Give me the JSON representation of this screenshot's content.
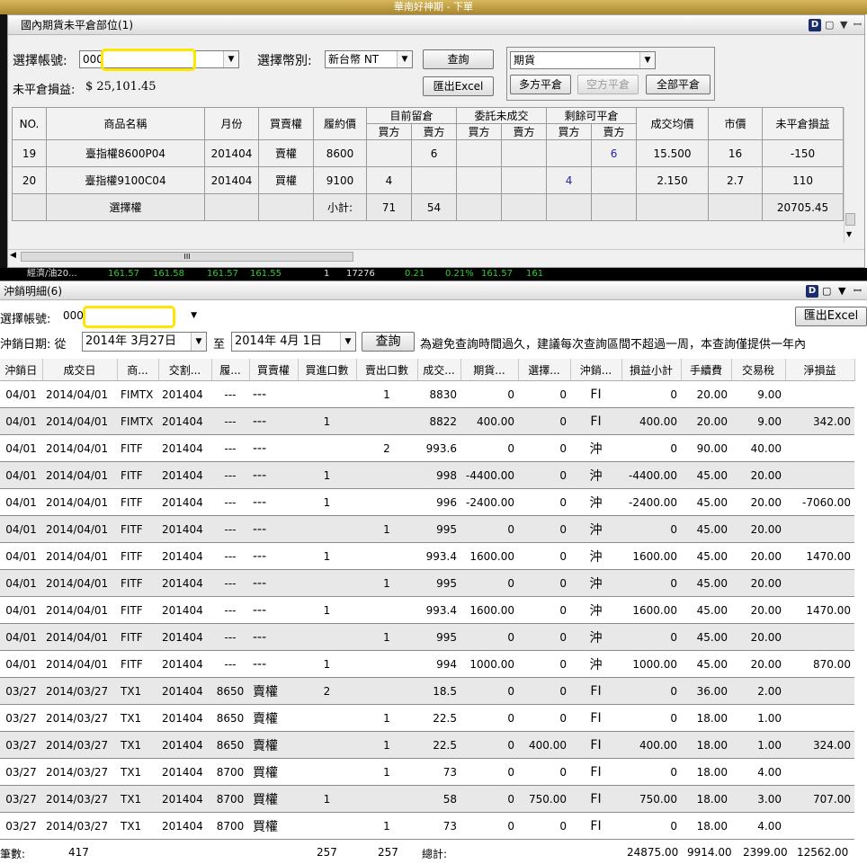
{
  "window": {
    "title": "華南好神期 - 下單"
  },
  "panel1": {
    "title": "國內期貨未平倉部位(1)",
    "account_label": "選擇帳號:",
    "account_value": "000",
    "currency_label": "選擇幣別:",
    "currency_value": "新台幣 NT",
    "query_button": "查詢",
    "export_button": "匯出Excel",
    "product_type": "期貨",
    "btn_long_close": "多方平倉",
    "btn_short_close": "空方平倉",
    "btn_all_close": "全部平倉",
    "unrealized_label": "未平倉損益:",
    "unrealized_value": "$ 25,101.45",
    "columns": {
      "no": "NO.",
      "product": "商品名稱",
      "month": "月份",
      "buysell": "買賣權",
      "strike": "履約價",
      "current_hold": "目前留倉",
      "pending": "委託未成交",
      "remaining": "剩餘可平倉",
      "buy": "買方",
      "sell": "賣方",
      "avg_price": "成交均價",
      "market_price": "市價",
      "unrealized_pl": "未平倉損益"
    },
    "rows": [
      {
        "no": "19",
        "product": "臺指權8600P04",
        "month": "201404",
        "buysell": "賣權",
        "strike": "8600",
        "hold_buy": "",
        "hold_sell": "6",
        "pend_buy": "",
        "pend_sell": "",
        "rem_buy": "",
        "rem_sell": "6",
        "avg": "15.500",
        "mkt": "16",
        "pl": "-150"
      },
      {
        "no": "20",
        "product": "臺指權9100C04",
        "month": "201404",
        "buysell": "買權",
        "strike": "9100",
        "hold_buy": "4",
        "hold_sell": "",
        "pend_buy": "",
        "pend_sell": "",
        "rem_buy": "4",
        "rem_sell": "",
        "avg": "2.150",
        "mkt": "2.7",
        "pl": "110"
      }
    ],
    "subtotal": {
      "product": "選擇權",
      "label": "小計:",
      "hold_buy": "71",
      "hold_sell": "54",
      "pl": "20705.45"
    },
    "scroll_grip": "III",
    "ticker_row": [
      "經濟/油20...",
      "161.57",
      "161.58",
      "161.57",
      "161.55",
      "1",
      "17276",
      "0.21",
      "0.21%",
      "161.57",
      "161"
    ]
  },
  "panel2": {
    "title": "沖銷明細(6)",
    "account_label": "選擇帳號:",
    "account_value": "000",
    "export_button": "匯出Excel",
    "date_label": "沖銷日期: 從",
    "date_from": "2014年  3月27日",
    "date_to_label": "至",
    "date_to": "2014年  4月  1日",
    "query_button": "查詢",
    "notice": "為避免查詢時間過久，建議每次查詢區間不超過一周，本查詢僅提供一年內",
    "columns": [
      "沖銷日",
      "成交日",
      "商...",
      "交割...",
      "履...",
      "買賣權",
      "買進口數",
      "賣出口數",
      "成交...",
      "期貨...",
      "選擇...",
      "沖銷...",
      "損益小計",
      "手續費",
      "交易稅",
      "淨損益"
    ],
    "rows": [
      [
        "04/01",
        "2014/04/01",
        "FIMTX",
        "201404",
        "---",
        "---",
        "",
        "1",
        "8830",
        "0",
        "0",
        "FI",
        "0",
        "20.00",
        "9.00",
        ""
      ],
      [
        "04/01",
        "2014/04/01",
        "FIMTX",
        "201404",
        "---",
        "---",
        "1",
        "",
        "8822",
        "400.00",
        "0",
        "FI",
        "400.00",
        "20.00",
        "9.00",
        "342.00"
      ],
      [
        "04/01",
        "2014/04/01",
        "FITF",
        "201404",
        "---",
        "---",
        "",
        "2",
        "993.6",
        "0",
        "0",
        "沖",
        "0",
        "90.00",
        "40.00",
        ""
      ],
      [
        "04/01",
        "2014/04/01",
        "FITF",
        "201404",
        "---",
        "---",
        "1",
        "",
        "998",
        "-4400.00",
        "0",
        "沖",
        "-4400.00",
        "45.00",
        "20.00",
        ""
      ],
      [
        "04/01",
        "2014/04/01",
        "FITF",
        "201404",
        "---",
        "---",
        "1",
        "",
        "996",
        "-2400.00",
        "0",
        "沖",
        "-2400.00",
        "45.00",
        "20.00",
        "-7060.00"
      ],
      [
        "04/01",
        "2014/04/01",
        "FITF",
        "201404",
        "---",
        "---",
        "",
        "1",
        "995",
        "0",
        "0",
        "沖",
        "0",
        "45.00",
        "20.00",
        ""
      ],
      [
        "04/01",
        "2014/04/01",
        "FITF",
        "201404",
        "---",
        "---",
        "1",
        "",
        "993.4",
        "1600.00",
        "0",
        "沖",
        "1600.00",
        "45.00",
        "20.00",
        "1470.00"
      ],
      [
        "04/01",
        "2014/04/01",
        "FITF",
        "201404",
        "---",
        "---",
        "",
        "1",
        "995",
        "0",
        "0",
        "沖",
        "0",
        "45.00",
        "20.00",
        ""
      ],
      [
        "04/01",
        "2014/04/01",
        "FITF",
        "201404",
        "---",
        "---",
        "1",
        "",
        "993.4",
        "1600.00",
        "0",
        "沖",
        "1600.00",
        "45.00",
        "20.00",
        "1470.00"
      ],
      [
        "04/01",
        "2014/04/01",
        "FITF",
        "201404",
        "---",
        "---",
        "",
        "1",
        "995",
        "0",
        "0",
        "沖",
        "0",
        "45.00",
        "20.00",
        ""
      ],
      [
        "04/01",
        "2014/04/01",
        "FITF",
        "201404",
        "---",
        "---",
        "1",
        "",
        "994",
        "1000.00",
        "0",
        "沖",
        "1000.00",
        "45.00",
        "20.00",
        "870.00"
      ],
      [
        "03/27",
        "2014/03/27",
        "TX1",
        "201404",
        "8650",
        "賣權",
        "2",
        "",
        "18.5",
        "0",
        "0",
        "FI",
        "0",
        "36.00",
        "2.00",
        ""
      ],
      [
        "03/27",
        "2014/03/27",
        "TX1",
        "201404",
        "8650",
        "賣權",
        "",
        "1",
        "22.5",
        "0",
        "0",
        "FI",
        "0",
        "18.00",
        "1.00",
        ""
      ],
      [
        "03/27",
        "2014/03/27",
        "TX1",
        "201404",
        "8650",
        "賣權",
        "",
        "1",
        "22.5",
        "0",
        "400.00",
        "FI",
        "400.00",
        "18.00",
        "1.00",
        "324.00"
      ],
      [
        "03/27",
        "2014/03/27",
        "TX1",
        "201404",
        "8700",
        "買權",
        "",
        "1",
        "73",
        "0",
        "0",
        "FI",
        "0",
        "18.00",
        "4.00",
        ""
      ],
      [
        "03/27",
        "2014/03/27",
        "TX1",
        "201404",
        "8700",
        "買權",
        "1",
        "",
        "58",
        "0",
        "750.00",
        "FI",
        "750.00",
        "18.00",
        "3.00",
        "707.00"
      ],
      [
        "03/27",
        "2014/03/27",
        "TX1",
        "201404",
        "8700",
        "買權",
        "",
        "1",
        "73",
        "0",
        "0",
        "FI",
        "0",
        "18.00",
        "4.00",
        ""
      ]
    ],
    "footer": {
      "count_label": "筆數:",
      "count_value": "417",
      "buy_total": "257",
      "sell_total": "257",
      "total_label": "總計:",
      "pl_total": "24875.00",
      "fee_total": "9914.00",
      "tax_total": "2399.00",
      "net_total": "12562.00"
    }
  }
}
